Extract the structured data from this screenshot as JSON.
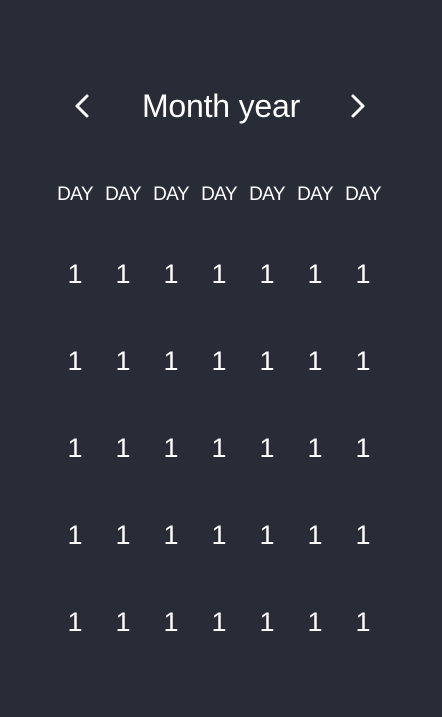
{
  "header": {
    "title": "Month year",
    "prev_icon": "chevron-left-icon",
    "next_icon": "chevron-right-icon"
  },
  "weekdays": [
    "DAY",
    "DAY",
    "DAY",
    "DAY",
    "DAY",
    "DAY",
    "DAY"
  ],
  "weeks": [
    [
      "1",
      "1",
      "1",
      "1",
      "1",
      "1",
      "1"
    ],
    [
      "1",
      "1",
      "1",
      "1",
      "1",
      "1",
      "1"
    ],
    [
      "1",
      "1",
      "1",
      "1",
      "1",
      "1",
      "1"
    ],
    [
      "1",
      "1",
      "1",
      "1",
      "1",
      "1",
      "1"
    ],
    [
      "1",
      "1",
      "1",
      "1",
      "1",
      "1",
      "1"
    ]
  ],
  "colors": {
    "background": "#282c36",
    "text": "#ffffff"
  }
}
